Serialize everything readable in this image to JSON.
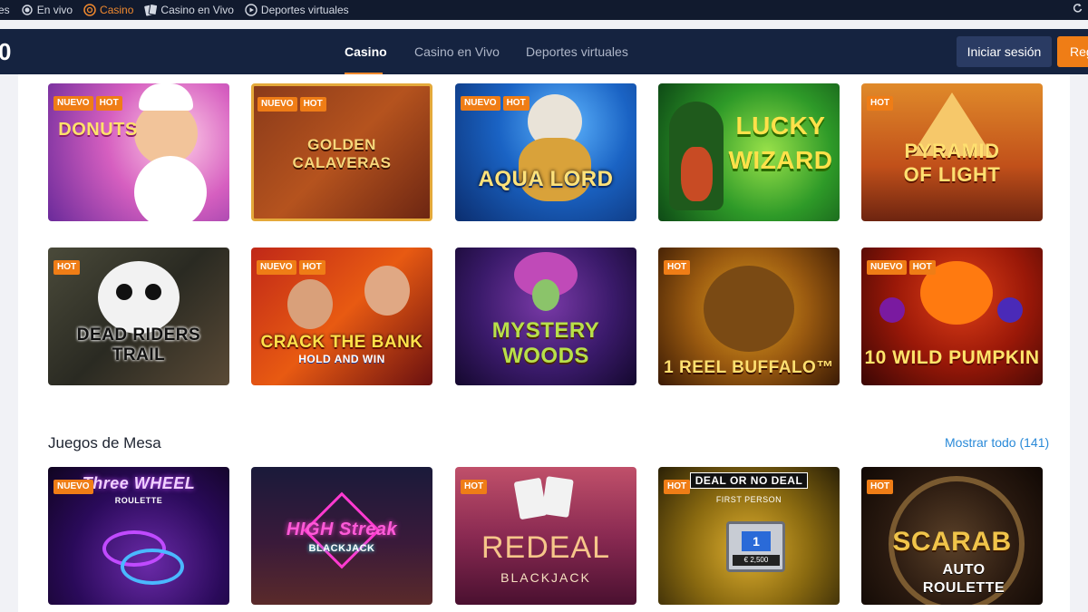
{
  "topbar": {
    "items": [
      {
        "label": "es",
        "icon": "none"
      },
      {
        "label": "En vivo",
        "icon": "live-dot-icon"
      },
      {
        "label": "Casino",
        "icon": "casino-chip-icon"
      },
      {
        "label": "Casino en Vivo",
        "icon": "cards-icon"
      },
      {
        "label": "Deportes virtuales",
        "icon": "play-circle-icon"
      }
    ],
    "right_icon": "refresh-icon"
  },
  "header": {
    "logo": "0",
    "tabs": [
      {
        "label": "Casino",
        "active": true
      },
      {
        "label": "Casino en Vivo",
        "active": false
      },
      {
        "label": "Deportes virtuales",
        "active": false
      }
    ],
    "login_label": "Iniciar sesión",
    "register_label": "Reg"
  },
  "badges": {
    "nuevo": "NUEVO",
    "hot": "HOT"
  },
  "games_row1": [
    {
      "title": "DONUTS",
      "nuevo": true,
      "hot": true
    },
    {
      "title": "GOLDEN CALAVERAS",
      "nuevo": true,
      "hot": true
    },
    {
      "title": "AQUA LORD",
      "nuevo": true,
      "hot": true
    },
    {
      "title": "LUCKY WIZARD",
      "nuevo": false,
      "hot": false
    },
    {
      "title": "PYRAMID OF LIGHT",
      "nuevo": false,
      "hot": true
    }
  ],
  "games_row2": [
    {
      "title": "DEAD RIDERS TRAIL",
      "nuevo": false,
      "hot": true
    },
    {
      "title": "CRACK THE BANK",
      "subtitle": "HOLD AND WIN",
      "nuevo": true,
      "hot": true
    },
    {
      "title": "MYSTERY WOODS",
      "nuevo": false,
      "hot": false
    },
    {
      "title": "1 REEL BUFFALO™",
      "nuevo": false,
      "hot": true
    },
    {
      "title": "10 WILD PUMPKIN",
      "nuevo": true,
      "hot": true
    }
  ],
  "table_section": {
    "title": "Juegos de Mesa",
    "show_all": "Mostrar todo (141)"
  },
  "games_row3": [
    {
      "title": "Three WHEEL",
      "subtitle": "ROULETTE",
      "nuevo": true,
      "hot": false
    },
    {
      "title": "HIGH Streak",
      "subtitle": "BLACKJACK",
      "nuevo": false,
      "hot": false
    },
    {
      "title": "REDEAL",
      "subtitle": "BLACKJACK",
      "nuevo": false,
      "hot": true
    },
    {
      "title": "DEAL OR NO DEAL",
      "subtitle": "FIRST PERSON",
      "extra": "1",
      "extra2": "€ 2,500",
      "nuevo": false,
      "hot": true
    },
    {
      "title": "SCARAB",
      "subtitle": "AUTO ROULETTE",
      "nuevo": false,
      "hot": true
    }
  ],
  "colors": {
    "accent": "#ef7d16",
    "header_bg": "#152340",
    "topbar_bg": "#111a2e",
    "link": "#2a8ad8"
  }
}
